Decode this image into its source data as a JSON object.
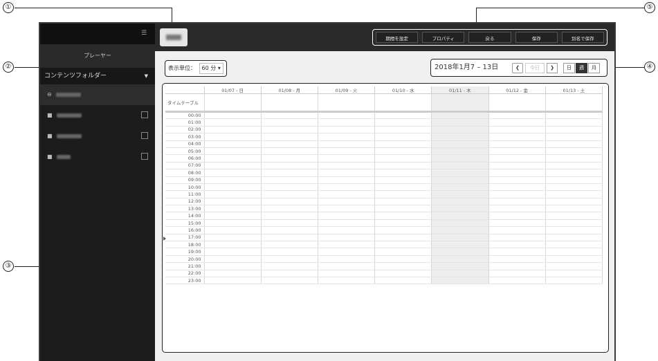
{
  "callouts": [
    "①",
    "②",
    "③",
    "④",
    "⑤"
  ],
  "sidebar": {
    "player_label": "プレーヤー",
    "folder_label": "コンテンツフォルダー",
    "items": [
      {
        "icon": "back-arrow-icon"
      },
      {
        "icon": "folder-icon"
      },
      {
        "icon": "folder-icon"
      },
      {
        "icon": "folder-icon"
      }
    ]
  },
  "toolbar": {
    "buttons": [
      "期間を設定",
      "プロパティ",
      "戻る",
      "保存",
      "別名で保存"
    ]
  },
  "unit": {
    "label": "表示単位：",
    "value": "60 分",
    "caret": "▾"
  },
  "datenav": {
    "range": "2018年1月7 – 13日",
    "prev": "❮",
    "today": "今日",
    "next": "❯",
    "views": [
      "日",
      "週",
      "月"
    ]
  },
  "schedule": {
    "corner_label": "タイムテーブル",
    "days": [
      "01/07 - 日",
      "01/08 - 月",
      "01/09 - 火",
      "01/10 - 水",
      "01/11 - 木",
      "01/12 - 金",
      "01/13 - 土"
    ],
    "times": [
      "00:00",
      "01:00",
      "02:00",
      "03:00",
      "04:00",
      "05:00",
      "06:00",
      "07:00",
      "08:00",
      "09:00",
      "10:00",
      "11:00",
      "12:00",
      "13:00",
      "14:00",
      "15:00",
      "16:00",
      "17:00",
      "18:00",
      "19:00",
      "20:00",
      "21:00",
      "22:00",
      "23:00"
    ]
  }
}
